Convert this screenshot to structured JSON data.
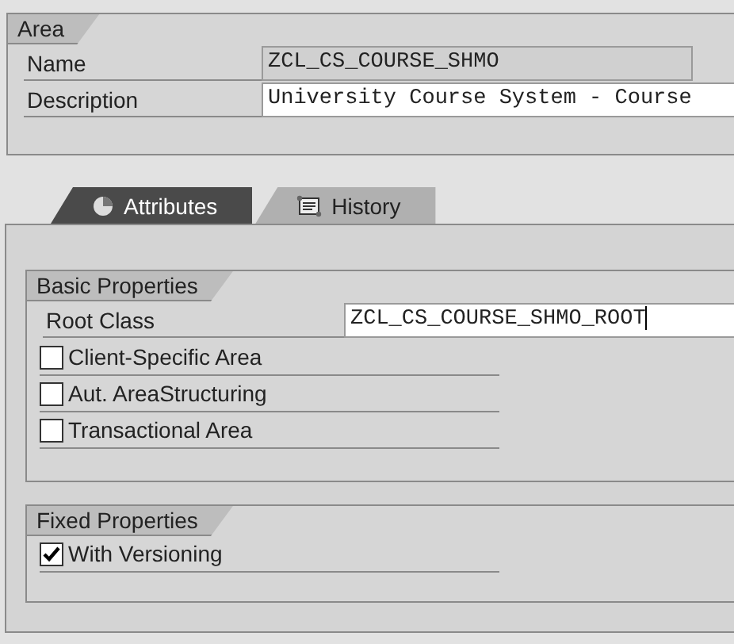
{
  "area": {
    "title": "Area",
    "fields": [
      {
        "label": "Name",
        "value": "ZCL_CS_COURSE_SHMO",
        "editable": false
      },
      {
        "label": "Description",
        "value": "University Course System - Course",
        "editable": true
      }
    ]
  },
  "tabs": [
    {
      "label": "Attributes",
      "selected": true,
      "kind": "attributes"
    },
    {
      "label": "History",
      "selected": false,
      "kind": "history"
    }
  ],
  "basic_properties": {
    "title": "Basic Properties",
    "root_class": {
      "label": "Root Class",
      "value": "ZCL_CS_COURSE_SHMO_ROOT"
    },
    "options": [
      {
        "label": "Client-Specific Area",
        "checked": false
      },
      {
        "label": "Aut. AreaStructuring",
        "checked": false
      },
      {
        "label": "Transactional Area",
        "checked": false
      }
    ]
  },
  "fixed_properties": {
    "title": "Fixed Properties",
    "options": [
      {
        "label": "With Versioning",
        "checked": true
      }
    ]
  }
}
